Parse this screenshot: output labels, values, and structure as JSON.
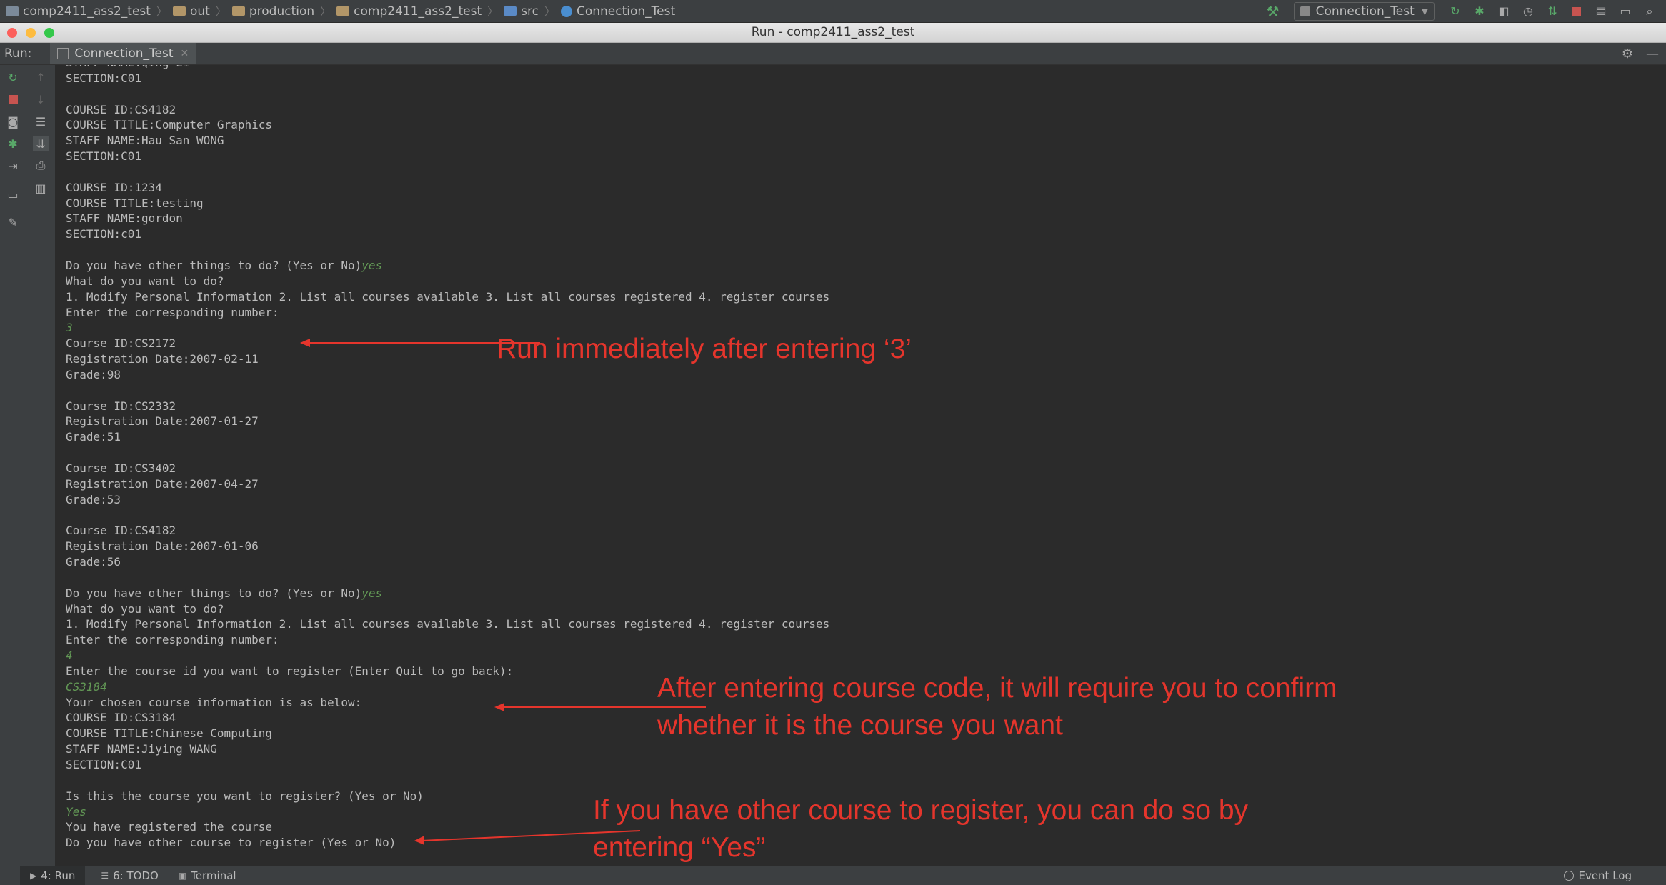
{
  "navbar": {
    "crumbs": [
      "comp2411_ass2_test",
      "out",
      "production",
      "comp2411_ass2_test",
      "src",
      "Connection_Test"
    ],
    "run_config": "Connection_Test"
  },
  "window_title": "Run - comp2411_ass2_test",
  "toolwindow": {
    "label": "Run:",
    "tab": "Connection_Test"
  },
  "console": {
    "lines": [
      {
        "text": "STAFF NAME:Qing Li"
      },
      {
        "text": "SECTION:C01"
      },
      {
        "text": ""
      },
      {
        "text": "COURSE ID:CS4182"
      },
      {
        "text": "COURSE TITLE:Computer Graphics"
      },
      {
        "text": "STAFF NAME:Hau San WONG"
      },
      {
        "text": "SECTION:C01"
      },
      {
        "text": ""
      },
      {
        "text": "COURSE ID:1234"
      },
      {
        "text": "COURSE TITLE:testing"
      },
      {
        "text": "STAFF NAME:gordon"
      },
      {
        "text": "SECTION:c01"
      },
      {
        "text": ""
      },
      {
        "text": "Do you have other things to do? (Yes or No)",
        "input": "yes"
      },
      {
        "text": "What do you want to do?"
      },
      {
        "text": "1. Modify Personal Information 2. List all courses available 3. List all courses registered 4. register courses"
      },
      {
        "text": "Enter the corresponding number:"
      },
      {
        "text": "",
        "input": "3"
      },
      {
        "text": "Course ID:CS2172"
      },
      {
        "text": "Registration Date:2007-02-11"
      },
      {
        "text": "Grade:98"
      },
      {
        "text": ""
      },
      {
        "text": "Course ID:CS2332"
      },
      {
        "text": "Registration Date:2007-01-27"
      },
      {
        "text": "Grade:51"
      },
      {
        "text": ""
      },
      {
        "text": "Course ID:CS3402"
      },
      {
        "text": "Registration Date:2007-04-27"
      },
      {
        "text": "Grade:53"
      },
      {
        "text": ""
      },
      {
        "text": "Course ID:CS4182"
      },
      {
        "text": "Registration Date:2007-01-06"
      },
      {
        "text": "Grade:56"
      },
      {
        "text": ""
      },
      {
        "text": "Do you have other things to do? (Yes or No)",
        "input": "yes"
      },
      {
        "text": "What do you want to do?"
      },
      {
        "text": "1. Modify Personal Information 2. List all courses available 3. List all courses registered 4. register courses"
      },
      {
        "text": "Enter the corresponding number:"
      },
      {
        "text": "",
        "input": "4"
      },
      {
        "text": "Enter the course id you want to register (Enter Quit to go back):"
      },
      {
        "text": "",
        "input": "CS3184"
      },
      {
        "text": "Your chosen course information is as below:"
      },
      {
        "text": "COURSE ID:CS3184"
      },
      {
        "text": "COURSE TITLE:Chinese Computing"
      },
      {
        "text": "STAFF NAME:Jiying WANG"
      },
      {
        "text": "SECTION:C01"
      },
      {
        "text": ""
      },
      {
        "text": "Is this the course you want to register? (Yes or No)"
      },
      {
        "text": "",
        "input": "Yes"
      },
      {
        "text": "You have registered the course"
      },
      {
        "text": "Do you have other course to register (Yes or No)"
      }
    ]
  },
  "annotations": {
    "a1": "Run immediately after entering ‘3’",
    "a2_line1": "After entering course code, it will require you to confirm",
    "a2_line2": "whether it is the course you want",
    "a3_line1": "If you have other course to register, you can do so by",
    "a3_line2": "entering “Yes”",
    "color": "#e5352c"
  },
  "statusbar": {
    "tab_run": "4: Run",
    "tab_todo": "6: TODO",
    "tab_terminal": "Terminal",
    "event_log": "Event Log"
  }
}
